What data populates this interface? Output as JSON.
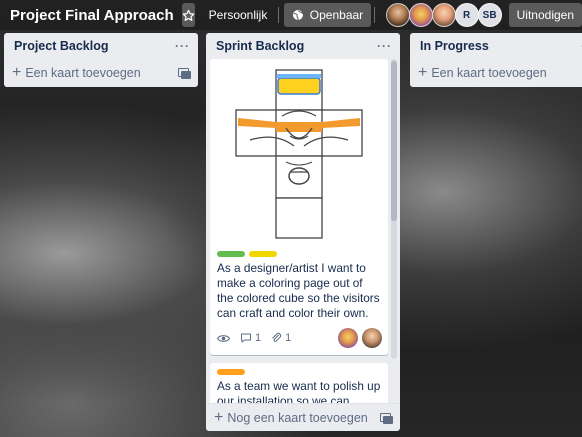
{
  "board": {
    "title": "Project Final Approach",
    "visibility_team": "Persoonlijk",
    "visibility_public": "Openbaar",
    "members": [
      {
        "initials": ""
      },
      {
        "initials": ""
      },
      {
        "initials": ""
      },
      {
        "initials": "R"
      },
      {
        "initials": "SB"
      }
    ],
    "invite_label": "Uitnodigen"
  },
  "lists": [
    {
      "title": "Project Backlog",
      "add_card": "Een kaart toevoegen"
    },
    {
      "title": "Sprint Backlog",
      "add_card": "Nog een kaart toevoegen",
      "cards": [
        {
          "labels": [
            "#61bd4f",
            "#f2d600"
          ],
          "title": "As a designer/artist I want to make a coloring page out of the colored cube so the visitors can craft and color their own.",
          "comments": "1",
          "attachments": "1"
        },
        {
          "labels": [
            "#ff9f1a"
          ],
          "title": "As a team we want to polish up our installation so we can preform professionally at the makers festival"
        }
      ]
    },
    {
      "title": "In Progress",
      "add_card": "Een kaart toevoegen"
    }
  ],
  "colors": {
    "label_green": "#61bd4f",
    "label_yellow": "#f2d600",
    "label_orange": "#ff9f1a"
  }
}
